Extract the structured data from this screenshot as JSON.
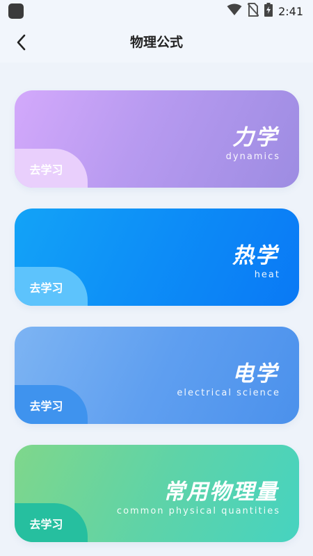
{
  "status_bar": {
    "time": "2:41",
    "icons": [
      "app-icon",
      "wifi-icon",
      "no-sim-icon",
      "battery-charging-icon"
    ]
  },
  "header": {
    "back_icon": "chevron-left-icon",
    "title": "物理公式"
  },
  "cards": [
    {
      "title": "力学",
      "subtitle": "dynamics",
      "button_label": "去学习"
    },
    {
      "title": "热学",
      "subtitle": "heat",
      "button_label": "去学习"
    },
    {
      "title": "电学",
      "subtitle": "electrical science",
      "button_label": "去学习"
    },
    {
      "title": "常用物理量",
      "subtitle": "common physical quantities",
      "button_label": "去学习"
    }
  ]
}
